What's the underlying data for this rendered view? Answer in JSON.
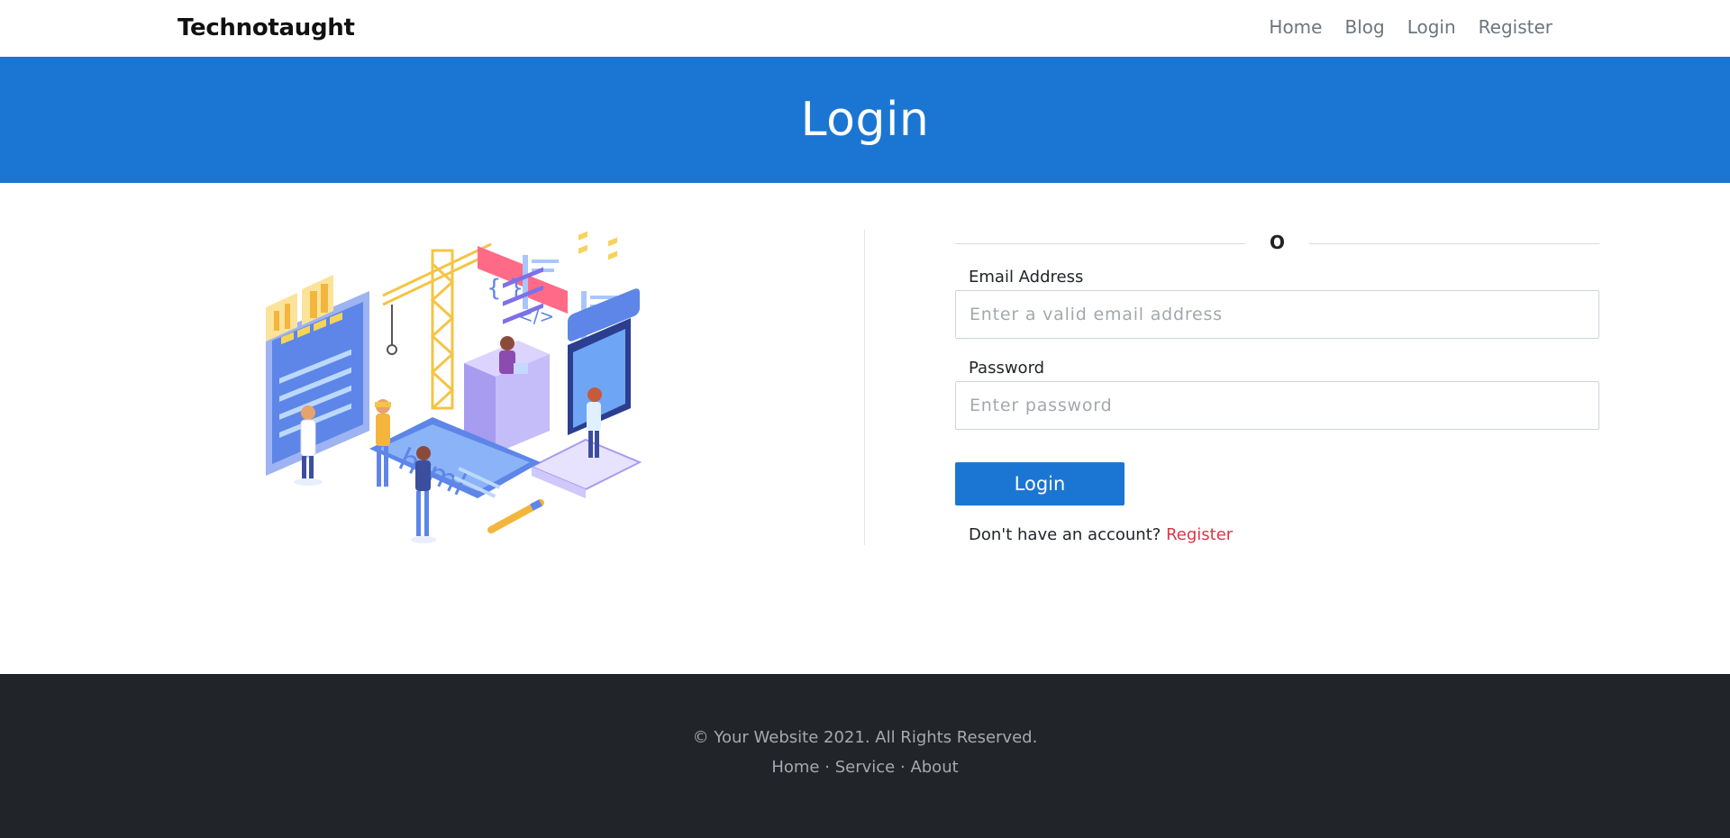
{
  "navbar": {
    "brand": "Technotaught",
    "links": [
      "Home",
      "Blog",
      "Login",
      "Register"
    ]
  },
  "hero": {
    "title": "Login"
  },
  "form": {
    "divider_text": "O",
    "email": {
      "label": "Email Address",
      "placeholder": "Enter a valid email address",
      "value": ""
    },
    "password": {
      "label": "Password",
      "placeholder": "Enter password",
      "value": ""
    },
    "submit_label": "Login",
    "no_account_text": "Don't have an account?",
    "register_link": "Register"
  },
  "footer": {
    "copyright": "© Your Website 2021. All Rights Reserved.",
    "links": [
      "Home",
      "Service",
      "About"
    ],
    "separator": "·"
  },
  "colors": {
    "primary": "#1b76d3",
    "footer_bg": "#212429",
    "link_red": "#dc3545"
  }
}
